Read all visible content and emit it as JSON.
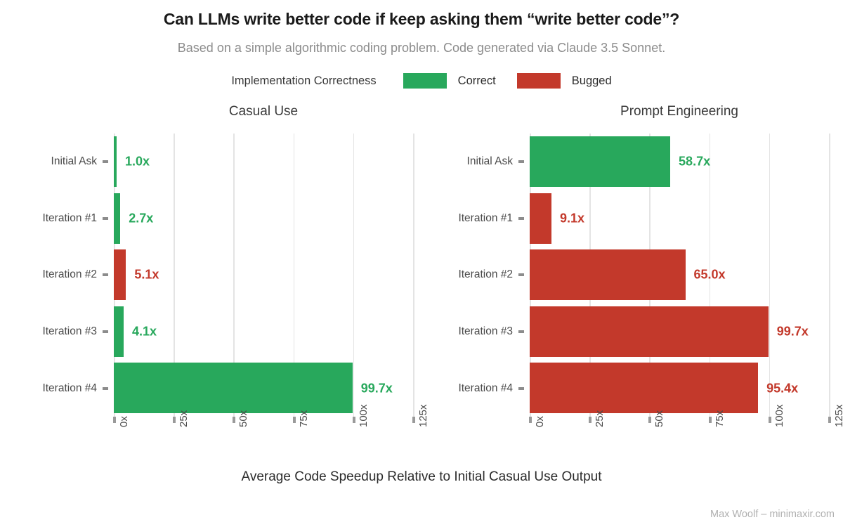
{
  "header": {
    "title": "Can LLMs write better code if keep asking them “write better code”?",
    "subtitle": "Based on a simple algorithmic coding problem. Code generated via Claude 3.5 Sonnet."
  },
  "legend": {
    "title": "Implementation Correctness",
    "entries": [
      {
        "label": "Correct",
        "color": "#28a85c"
      },
      {
        "label": "Bugged",
        "color": "#c3392b"
      }
    ]
  },
  "caption": "Max Woolf – minimaxir.com",
  "colors": {
    "correct": "#28a85c",
    "bugged": "#c3392b",
    "grid": "#e4e4e4",
    "axis_text": "#4a4a4a",
    "subtitle": "#8c8c8c"
  },
  "chart_data": {
    "type": "bar",
    "orientation": "horizontal",
    "title": "Can LLMs write better code if keep asking them “write better code”?",
    "subtitle": "Based on a simple algorithmic coding problem. Code generated via Claude 3.5 Sonnet.",
    "xlabel": "Average Code Speedup Relative to Initial Casual Use Output",
    "ylabel": "",
    "xlim": [
      0,
      125
    ],
    "xticks": [
      0,
      25,
      50,
      75,
      100,
      125
    ],
    "xtick_labels": [
      "0x",
      "25x",
      "50x",
      "75x",
      "100x",
      "125x"
    ],
    "categories": [
      "Initial Ask",
      "Iteration #1",
      "Iteration #2",
      "Iteration #3",
      "Iteration #4"
    ],
    "grid": true,
    "legend_position": "top-center",
    "legend_title": "Implementation Correctness",
    "facets": [
      {
        "name": "Casual Use",
        "bars": [
          {
            "category": "Initial Ask",
            "value": 1.0,
            "label": "1.0x",
            "status": "Correct",
            "color": "#28a85c"
          },
          {
            "category": "Iteration #1",
            "value": 2.7,
            "label": "2.7x",
            "status": "Correct",
            "color": "#28a85c"
          },
          {
            "category": "Iteration #2",
            "value": 5.1,
            "label": "5.1x",
            "status": "Bugged",
            "color": "#c3392b"
          },
          {
            "category": "Iteration #3",
            "value": 4.1,
            "label": "4.1x",
            "status": "Correct",
            "color": "#28a85c"
          },
          {
            "category": "Iteration #4",
            "value": 99.7,
            "label": "99.7x",
            "status": "Correct",
            "color": "#28a85c"
          }
        ]
      },
      {
        "name": "Prompt Engineering",
        "bars": [
          {
            "category": "Initial Ask",
            "value": 58.7,
            "label": "58.7x",
            "status": "Correct",
            "color": "#28a85c"
          },
          {
            "category": "Iteration #1",
            "value": 9.1,
            "label": "9.1x",
            "status": "Bugged",
            "color": "#c3392b"
          },
          {
            "category": "Iteration #2",
            "value": 65.0,
            "label": "65.0x",
            "status": "Bugged",
            "color": "#c3392b"
          },
          {
            "category": "Iteration #3",
            "value": 99.7,
            "label": "99.7x",
            "status": "Bugged",
            "color": "#c3392b"
          },
          {
            "category": "Iteration #4",
            "value": 95.4,
            "label": "95.4x",
            "status": "Bugged",
            "color": "#c3392b"
          }
        ]
      }
    ]
  }
}
